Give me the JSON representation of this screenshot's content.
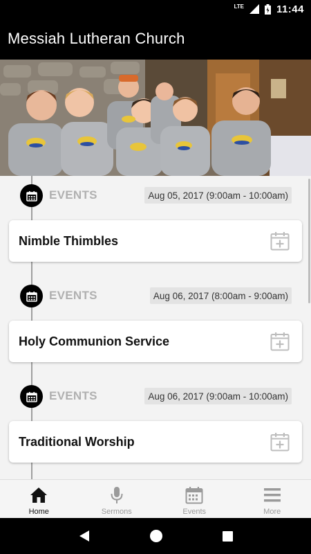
{
  "status_bar": {
    "network": "LTE",
    "time": "11:44"
  },
  "app_bar": {
    "title": "Messiah Lutheran Church"
  },
  "events": [
    {
      "label": "EVENTS",
      "date": "Aug 05, 2017 (9:00am - 10:00am)",
      "title": "Nimble Thimbles"
    },
    {
      "label": "EVENTS",
      "date": "Aug 06, 2017 (8:00am - 9:00am)",
      "title": "Holy Communion Service"
    },
    {
      "label": "EVENTS",
      "date": "Aug 06, 2017 (9:00am - 10:00am)",
      "title": "Traditional Worship"
    }
  ],
  "bottom_nav": {
    "items": [
      {
        "label": "Home",
        "icon": "home-icon",
        "active": true
      },
      {
        "label": "Sermons",
        "icon": "microphone-icon"
      },
      {
        "label": "Events",
        "icon": "calendar-icon"
      },
      {
        "label": "More",
        "icon": "menu-icon"
      }
    ]
  },
  "colors": {
    "app_bar": "#000000",
    "timeline": "#9e9e9e",
    "events_label": "#b0b0b0",
    "inactive": "#9a9a9a"
  }
}
